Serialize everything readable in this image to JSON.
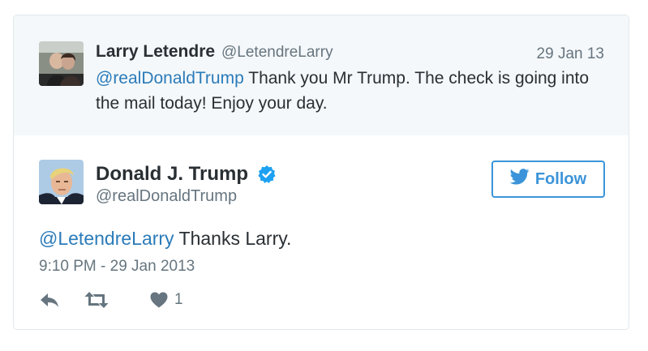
{
  "parent_tweet": {
    "name": "Larry Letendre",
    "handle": "@LetendreLarry",
    "date": "29 Jan 13",
    "mention": "@realDonaldTrump",
    "text": " Thank you Mr Trump. The check is going into the mail today! Enjoy your day."
  },
  "tweet": {
    "name": "Donald J. Trump",
    "handle": "@realDonaldTrump",
    "verified_icon": "verified-badge-icon",
    "follow_label": "Follow",
    "mention": "@LetendreLarry",
    "text": " Thanks Larry.",
    "timestamp": "9:10 PM - 29 Jan 2013",
    "like_count": "1"
  },
  "colors": {
    "link": "#2b7bb9",
    "follow": "#3b94d9",
    "verified": "#1da1f2",
    "muted": "#66757f",
    "parent_bg": "#f5f8fa"
  }
}
